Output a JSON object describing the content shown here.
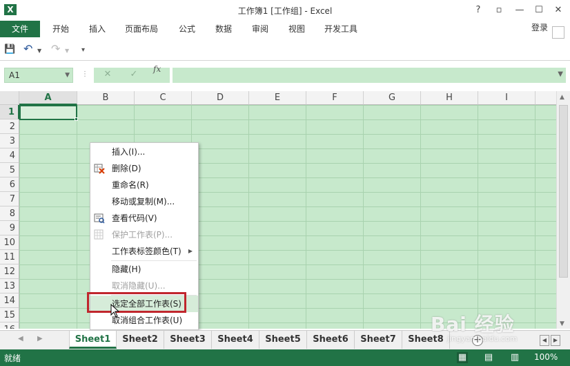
{
  "window": {
    "title": "工作簿1  [工作组] - Excel",
    "help": "?",
    "restore": "▫",
    "minimize": "—",
    "maximize": "☐",
    "close": "✕",
    "logo": "X"
  },
  "ribbon": {
    "file": "文件",
    "tabs": [
      "开始",
      "插入",
      "页面布局",
      "公式",
      "数据",
      "审阅",
      "视图",
      "开发工具"
    ],
    "login": "登录"
  },
  "qat": {
    "save": "💾",
    "undo": "↶",
    "redo": "↷",
    "customize": "▾"
  },
  "formula_bar": {
    "name_box": "A1",
    "cancel": "✕",
    "confirm": "✓",
    "fx": "fx",
    "value": ""
  },
  "grid": {
    "columns": [
      "A",
      "B",
      "C",
      "D",
      "E",
      "F",
      "G",
      "H",
      "I"
    ],
    "rows": [
      "1",
      "2",
      "3",
      "4",
      "5",
      "6",
      "7",
      "8",
      "9",
      "10",
      "11",
      "12",
      "13",
      "14",
      "15",
      "16"
    ],
    "selected_cell": "A1"
  },
  "context_menu": {
    "items": [
      {
        "label": "插入(I)...",
        "disabled": false
      },
      {
        "label": "删除(D)",
        "disabled": false,
        "icon": "delete-sheet-icon"
      },
      {
        "label": "重命名(R)",
        "disabled": false
      },
      {
        "label": "移动或复制(M)...",
        "disabled": false
      },
      {
        "label": "查看代码(V)",
        "disabled": false,
        "icon": "view-code-icon"
      },
      {
        "label": "保护工作表(P)...",
        "disabled": true,
        "icon": "protect-sheet-icon"
      },
      {
        "label": "工作表标签颜色(T)",
        "disabled": false,
        "submenu": true
      },
      {
        "label": "隐藏(H)",
        "disabled": false
      },
      {
        "label": "取消隐藏(U)...",
        "disabled": true
      },
      {
        "label": "选定全部工作表(S)",
        "disabled": false,
        "highlighted": true
      },
      {
        "label": "取消组合工作表(U)",
        "disabled": false
      }
    ]
  },
  "sheets": {
    "tabs": [
      "Sheet1",
      "Sheet2",
      "Sheet3",
      "Sheet4",
      "Sheet5",
      "Sheet6",
      "Sheet7",
      "Sheet8"
    ],
    "active": "Sheet1",
    "add": "+"
  },
  "status": {
    "ready": "就绪",
    "zoom": "100%",
    "zoom_minus": "−"
  },
  "watermark": {
    "text": "Bai  经验",
    "sub": "jingyan.baidu.com"
  },
  "colors": {
    "accent": "#217346",
    "selection_fill": "#c7e9cc",
    "highlight_border": "#c0262d"
  }
}
